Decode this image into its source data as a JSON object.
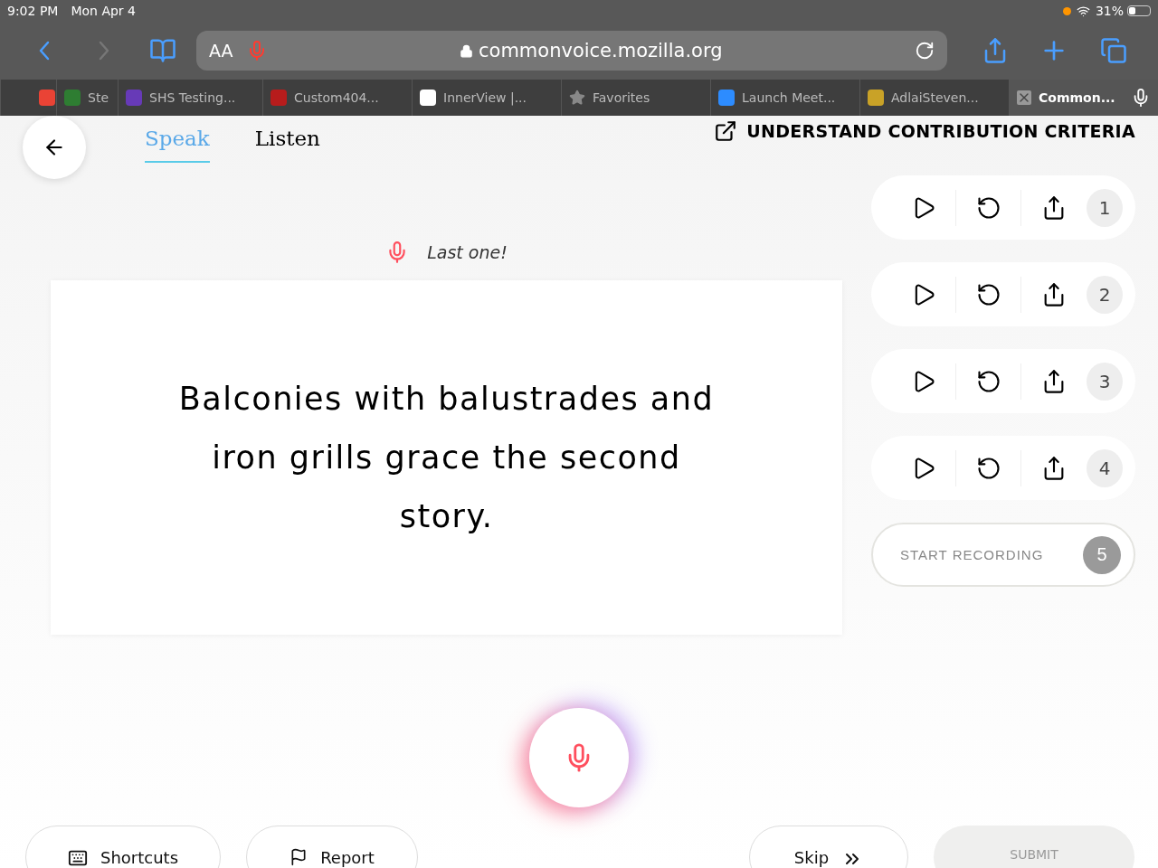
{
  "status_bar": {
    "time": "9:02 PM",
    "date": "Mon Apr 4",
    "battery": "31%"
  },
  "toolbar": {
    "text_size": "AA",
    "url": "commonvoice.mozilla.org"
  },
  "browser_tabs": [
    {
      "kind": "favicon",
      "color": "#ea4335",
      "selected": false
    },
    {
      "kind": "favicon",
      "label": "Ste",
      "color": "#2e7d32",
      "selected": false
    },
    {
      "kind": "favicon",
      "label": "SHS Testing...",
      "color": "#673ab7",
      "selected": false
    },
    {
      "kind": "favicon",
      "label": "Custom404...",
      "color": "#b71c1c",
      "selected": false
    },
    {
      "kind": "favicon",
      "label": "InnerView |...",
      "color": "#ffffff",
      "selected": false
    },
    {
      "kind": "star",
      "label": "Favorites",
      "selected": false
    },
    {
      "kind": "favicon",
      "label": "Launch Meet...",
      "color": "#2d8cff",
      "selected": false
    },
    {
      "kind": "favicon",
      "label": "AdlaiSteven...",
      "color": "#c9a227",
      "selected": false
    },
    {
      "kind": "close",
      "label": "Common...",
      "selected": true
    }
  ],
  "page": {
    "tabs": [
      {
        "label": "Speak",
        "selected": true
      },
      {
        "label": "Listen",
        "selected": false
      }
    ],
    "criteria_link": "UNDERSTAND CONTRIBUTION CRITERIA",
    "prompt": "Last one!",
    "sentence": "Balconies with balustrades and iron grills grace the second story.",
    "clips": [
      {
        "number": "1"
      },
      {
        "number": "2"
      },
      {
        "number": "3"
      },
      {
        "number": "4"
      }
    ],
    "start_recording": {
      "label": "START RECORDING",
      "number": "5"
    },
    "buttons": [
      {
        "kind": "shortcuts",
        "label": "Shortcuts",
        "disabled": false
      },
      {
        "kind": "report",
        "label": "Report",
        "disabled": false
      },
      {
        "kind": "skip",
        "label": "Skip",
        "disabled": false
      },
      {
        "kind": "submit",
        "label": "SUBMIT",
        "disabled": true
      }
    ]
  }
}
